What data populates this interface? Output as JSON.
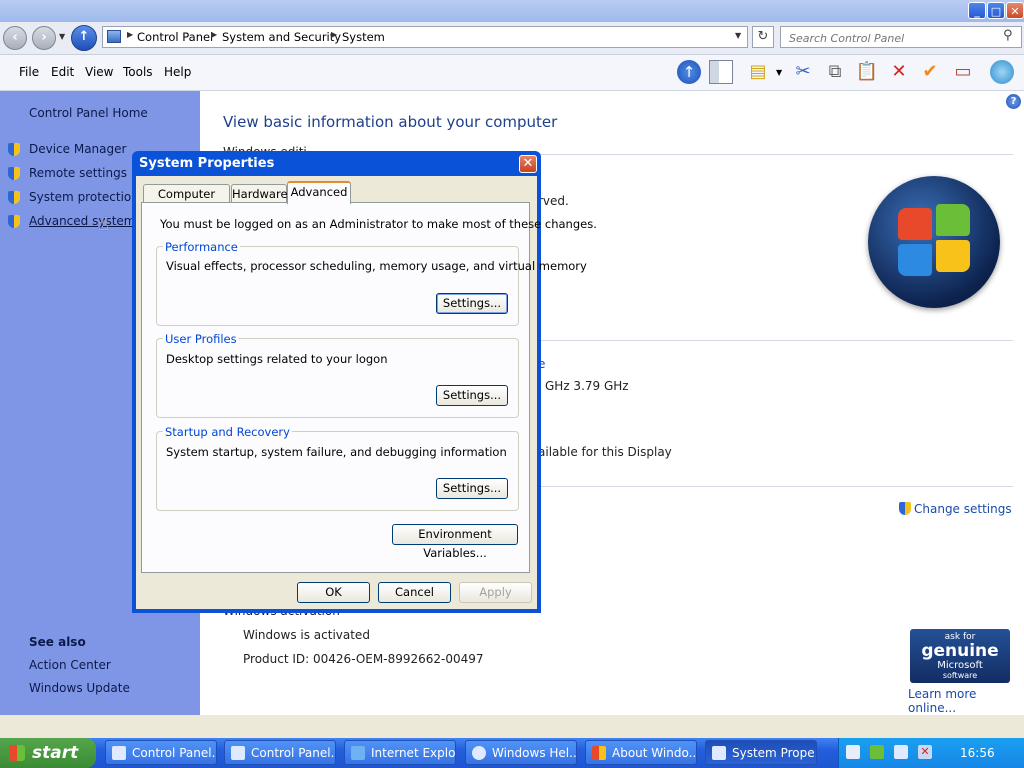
{
  "address": {
    "crumbs": [
      "Control Panel",
      "System and Security",
      "System"
    ],
    "search_placeholder": "Search Control Panel"
  },
  "menu": [
    "File",
    "Edit",
    "View",
    "Tools",
    "Help"
  ],
  "sidebar": {
    "home": "Control Panel Home",
    "tasks": [
      "Device Manager",
      "Remote settings",
      "System protection",
      "Advanced system se"
    ],
    "see_also_heading": "See also",
    "see_also": [
      "Action Center",
      "Windows Update"
    ]
  },
  "main": {
    "heading": "View basic information about your computer",
    "partial_under_dialog": "Windows editi",
    "reserved_fragment": "rved.",
    "link_fragment": "e",
    "cpu_fragment": "GHz  3.79 GHz",
    "display_fragment": "ailable for this Display",
    "change_settings": "Change settings",
    "activation_fragment": "Windows activation",
    "activated": "Windows is activated",
    "product_id": "Product ID: 00426-OEM-8992662-00497",
    "genuine": {
      "ask": "ask for",
      "word": "genuine",
      "ms": "Microsoft",
      "sw": "software"
    },
    "learn_more": "Learn more online..."
  },
  "dialog": {
    "title": "System Properties",
    "tabs": [
      "Computer Name",
      "Hardware",
      "Advanced"
    ],
    "active_tab": "Advanced",
    "admin_note": "You must be logged on as an Administrator to make most of these changes.",
    "groups": [
      {
        "legend": "Performance",
        "text": "Visual effects, processor scheduling, memory usage, and virtual memory",
        "button": "Settings..."
      },
      {
        "legend": "User Profiles",
        "text": "Desktop settings related to your logon",
        "button": "Settings..."
      },
      {
        "legend": "Startup and Recovery",
        "text": "System startup, system failure, and debugging information",
        "button": "Settings..."
      }
    ],
    "env_button": "Environment Variables...",
    "ok": "OK",
    "cancel": "Cancel",
    "apply": "Apply"
  },
  "taskbar": {
    "start": "start",
    "tasks": [
      "Control Panel...",
      "Control Panel...",
      "Internet Explo...",
      "Windows Hel...",
      "About Windo...",
      "System Prope..."
    ],
    "active_task": "System Prope...",
    "clock": "16:56"
  },
  "colors": {
    "sidebar": "#7f96e6",
    "dialog_title": "#0a52d8",
    "link": "#1a4aa8",
    "group_legend": "#0046d5",
    "taskbar": "#245edb",
    "start": "#3a8c34"
  }
}
